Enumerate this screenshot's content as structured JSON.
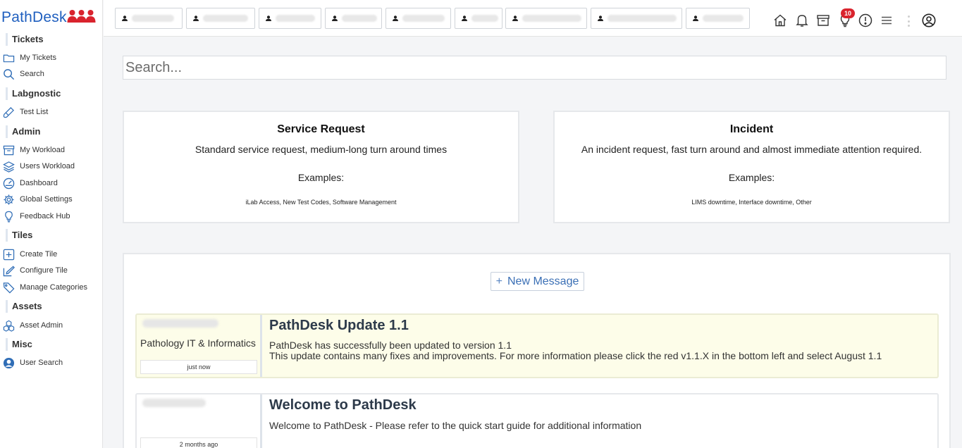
{
  "app": {
    "logo_text": "PathDesk"
  },
  "sidebar": {
    "sections": [
      {
        "label": "Tickets",
        "items": [
          {
            "label": "My Tickets",
            "icon": "folder-icon"
          },
          {
            "label": "Search",
            "icon": "search-icon"
          }
        ]
      },
      {
        "label": "Labgnostic",
        "items": [
          {
            "label": "Test List",
            "icon": "test-tube-icon"
          }
        ]
      },
      {
        "label": "Admin",
        "items": [
          {
            "label": "My Workload",
            "icon": "archive-icon"
          },
          {
            "label": "Users Workload",
            "icon": "stack-icon"
          },
          {
            "label": "Dashboard",
            "icon": "gauge-icon"
          },
          {
            "label": "Global Settings",
            "icon": "gear-icon"
          },
          {
            "label": "Feedback Hub",
            "icon": "lightbulb-icon"
          }
        ]
      },
      {
        "label": "Tiles",
        "items": [
          {
            "label": "Create Tile",
            "icon": "plus-square-icon"
          },
          {
            "label": "Configure Tile",
            "icon": "edit-icon"
          },
          {
            "label": "Manage Categories",
            "icon": "tags-icon"
          }
        ]
      },
      {
        "label": "Assets",
        "items": [
          {
            "label": "Asset Admin",
            "icon": "boxes-icon"
          }
        ]
      },
      {
        "label": "Misc",
        "items": [
          {
            "label": "User Search",
            "icon": "user-circle-icon"
          }
        ]
      }
    ]
  },
  "topbar": {
    "notification_count": "10",
    "icons": [
      "home-icon",
      "bell-icon",
      "archive-icon",
      "lightbulb-icon",
      "alert-circle-icon",
      "menu-icon",
      "kebab-icon",
      "user-circle-icon"
    ]
  },
  "search": {
    "placeholder": "Search..."
  },
  "cards": [
    {
      "title": "Service Request",
      "description": "Standard service request, medium-long turn around times",
      "examples_label": "Examples:",
      "examples": "iLab Access, New Test Codes, Software Management"
    },
    {
      "title": "Incident",
      "description": "An incident request, fast turn around and almost immediate attention required.",
      "examples_label": "Examples:",
      "examples": "LIMS downtime, Interface downtime, Other"
    }
  ],
  "messages_panel": {
    "new_message_label": "New Message",
    "messages": [
      {
        "org": "Pathology IT & Informatics",
        "time": "just now",
        "title": "PathDesk Update 1.1",
        "body_line1": "PathDesk has successfully been updated to version 1.1",
        "body_line2": "This update contains many fixes and improvements. For more information please click the red v1.1.X in the bottom left and select August 1.1"
      },
      {
        "org": "",
        "time": "2 months ago",
        "title": "Welcome to PathDesk",
        "body_line1": "Welcome to PathDesk - Please refer to the quick start guide for additional information",
        "body_line2": ""
      }
    ]
  },
  "colors": {
    "brand": "#1f5fbf",
    "accent_link": "#3a6fb5",
    "badge": "#d9232d",
    "highlight_bg": "#fdfde9"
  }
}
